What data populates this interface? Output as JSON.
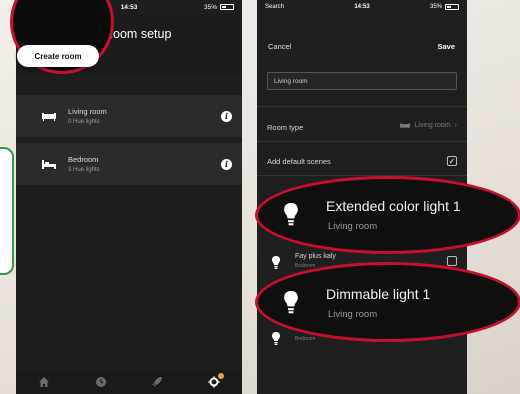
{
  "phone1": {
    "status": {
      "time": "14:53",
      "battery": "35%"
    },
    "title": "Room setup",
    "create_room_label": "Create room",
    "rooms": [
      {
        "name": "Living room",
        "sub": "0 Hue lights",
        "icon": "sofa-icon"
      },
      {
        "name": "Bedroom",
        "sub": "3 Hue lights",
        "icon": "bed-icon"
      }
    ],
    "tabs": [
      "home-icon",
      "clock-icon",
      "rocket-icon",
      "gear-icon"
    ]
  },
  "phone2": {
    "status": {
      "carrier": "Search",
      "time": "14:53",
      "battery": "35%"
    },
    "cancel_label": "Cancel",
    "save_label": "Save",
    "name_value": "Living room",
    "room_type_label": "Room type",
    "room_type_value": "Living room",
    "default_scenes_label": "Add default scenes",
    "lights": [
      {
        "name": "Fay plus kaly",
        "sub": "Bedroom"
      },
      {
        "name": "",
        "sub": "Bedroom"
      }
    ]
  },
  "highlights": [
    {
      "name": "Extended color light 1",
      "sub": "Living room"
    },
    {
      "name": "Dimmable light 1",
      "sub": "Living room"
    }
  ],
  "colors": {
    "accent": "#c8102e",
    "tab_badge": "#e8a43c",
    "dark_bg": "#1e1e1e"
  }
}
